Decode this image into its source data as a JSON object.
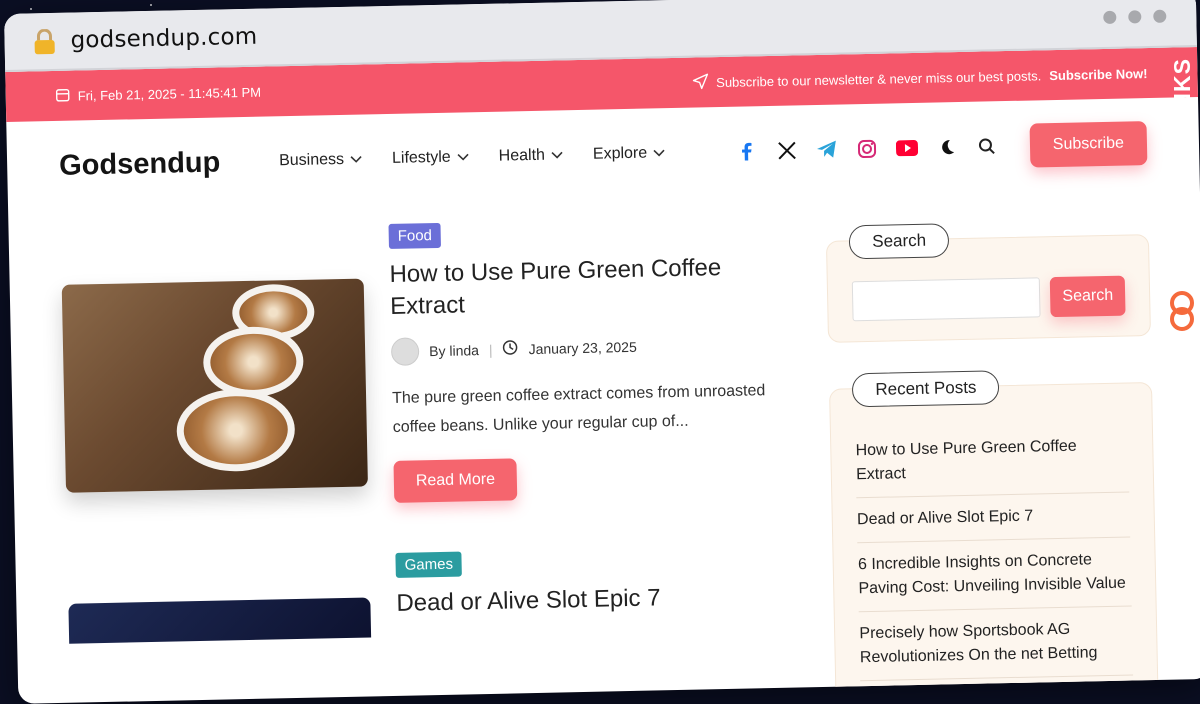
{
  "browser": {
    "url": "godsendup.com"
  },
  "topbar": {
    "datetime": "Fri, Feb 21, 2025 - 11:45:41 PM",
    "newsletter_text": "Subscribe to our newsletter & never miss our best posts.",
    "newsletter_link": "Subscribe Now!"
  },
  "header": {
    "logo": "Godsendup",
    "nav": [
      {
        "label": "Business"
      },
      {
        "label": "Lifestyle"
      },
      {
        "label": "Health"
      },
      {
        "label": "Explore"
      }
    ],
    "subscribe_label": "Subscribe"
  },
  "posts": [
    {
      "category": "Food",
      "category_color": "#6b6fd8",
      "title": "How to Use Pure Green Coffee Extract",
      "author": "By linda",
      "date": "January 23, 2025",
      "excerpt": "The pure green coffee extract comes from unroasted coffee beans. Unlike your regular cup of...",
      "read_more": "Read More"
    },
    {
      "category": "Games",
      "category_color": "#2b9ca0",
      "title": "Dead or Alive Slot Epic 7"
    }
  ],
  "sidebar": {
    "search_title": "Search",
    "search_button": "Search",
    "recent_title": "Recent Posts",
    "recent": [
      "How to Use Pure Green Coffee Extract",
      "Dead or Alive Slot Epic 7",
      "6 Incredible Insights on Concrete Paving Cost: Unveiling Invisible Value",
      "Precisely how Sportsbook AG Revolutionizes On the net Betting"
    ]
  },
  "brand_badge": "GUESTPOSTLINKS",
  "colors": {
    "accent": "#f5566a",
    "button": "#f5656e"
  }
}
